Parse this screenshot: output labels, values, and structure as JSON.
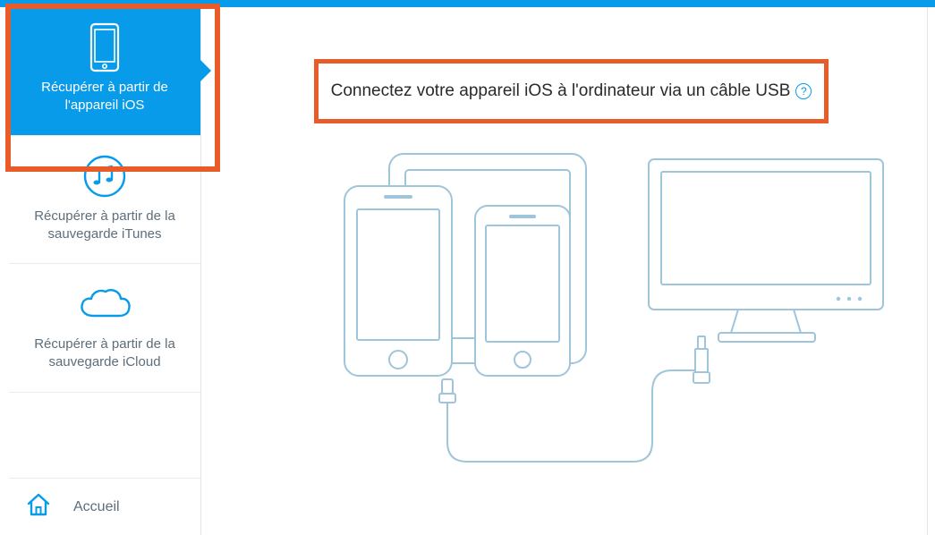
{
  "sidebar": {
    "items": [
      {
        "label": "Récupérer à partir de l'appareil iOS",
        "active": true
      },
      {
        "label": "Récupérer à partir de la sauvegarde iTunes",
        "active": false
      },
      {
        "label": "Récupérer à partir de la sauvegarde iCloud",
        "active": false
      }
    ],
    "home": "Accueil"
  },
  "main": {
    "instruction": "Connectez votre appareil iOS à l'ordinateur via un câble USB",
    "help": "?"
  },
  "colors": {
    "accent": "#079bea",
    "highlight": "#e85c2a",
    "outline": "#9fc5da"
  }
}
